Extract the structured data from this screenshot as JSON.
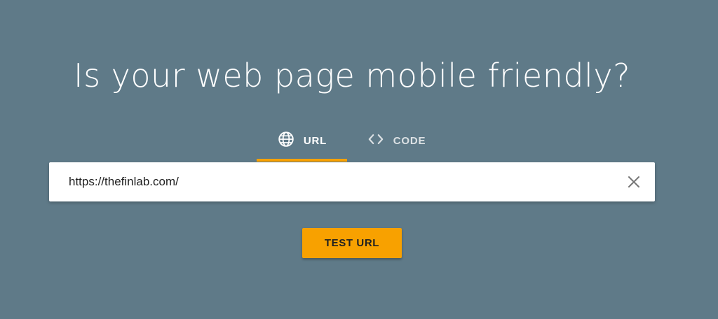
{
  "headline": "Is your web page mobile friendly?",
  "tabs": [
    {
      "label": "URL",
      "icon": "globe-icon",
      "active": true
    },
    {
      "label": "CODE",
      "icon": "code-brackets-icon",
      "active": false
    }
  ],
  "url_input": {
    "value": "https://thefinlab.com/",
    "clear_icon": "close-icon"
  },
  "test_button": {
    "label": "TEST URL"
  },
  "colors": {
    "background": "#5f7a88",
    "accent": "#f8a100",
    "text_light": "#ffffff",
    "text_dark": "#212121"
  }
}
